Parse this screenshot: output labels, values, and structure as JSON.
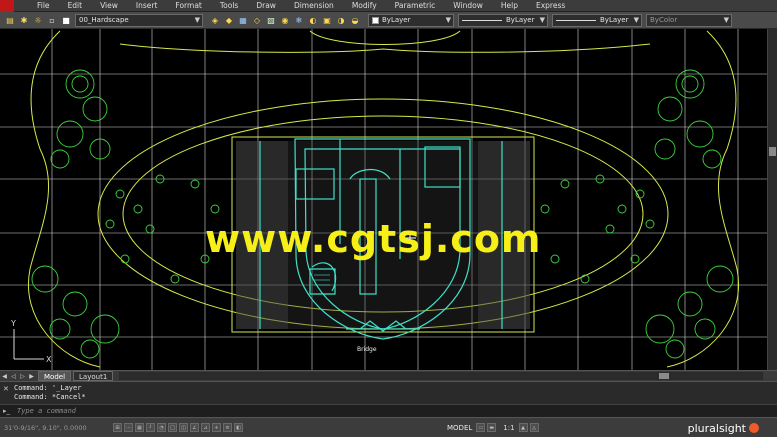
{
  "menubar": {
    "items": [
      "File",
      "Edit",
      "View",
      "Insert",
      "Format",
      "Tools",
      "Draw",
      "Dimension",
      "Modify",
      "Parametric",
      "Window",
      "Help",
      "Express"
    ]
  },
  "toolbar": {
    "layer_value": "00_Hardscape",
    "color_value": "ByLayer",
    "linetype_value": "ByLayer",
    "lineweight_value": "ByLayer",
    "plotstyle_value": "ByColor"
  },
  "drawing": {
    "label_bridge": "Bridge",
    "ucs_x": "X",
    "ucs_y": "Y"
  },
  "tabs": [
    "Model",
    "Layout1"
  ],
  "command": {
    "history": [
      "Command: '_Layer",
      "Command: *Cancel*"
    ],
    "placeholder": "Type a command"
  },
  "status": {
    "coordinates": "31'0-9/16\", 9.10\", 0.0000",
    "model_label": "MODEL",
    "scale_label": "1:1",
    "brand": "pluralsight"
  },
  "watermark": "www.cgtsj.com",
  "colors": {
    "background": "#000000",
    "linework_yellow": "#d8e84a",
    "building_cyan": "#40e0c8",
    "trees_green": "#3cd23c",
    "grid_white": "#e8e8e8",
    "watermark": "#f6f018"
  }
}
